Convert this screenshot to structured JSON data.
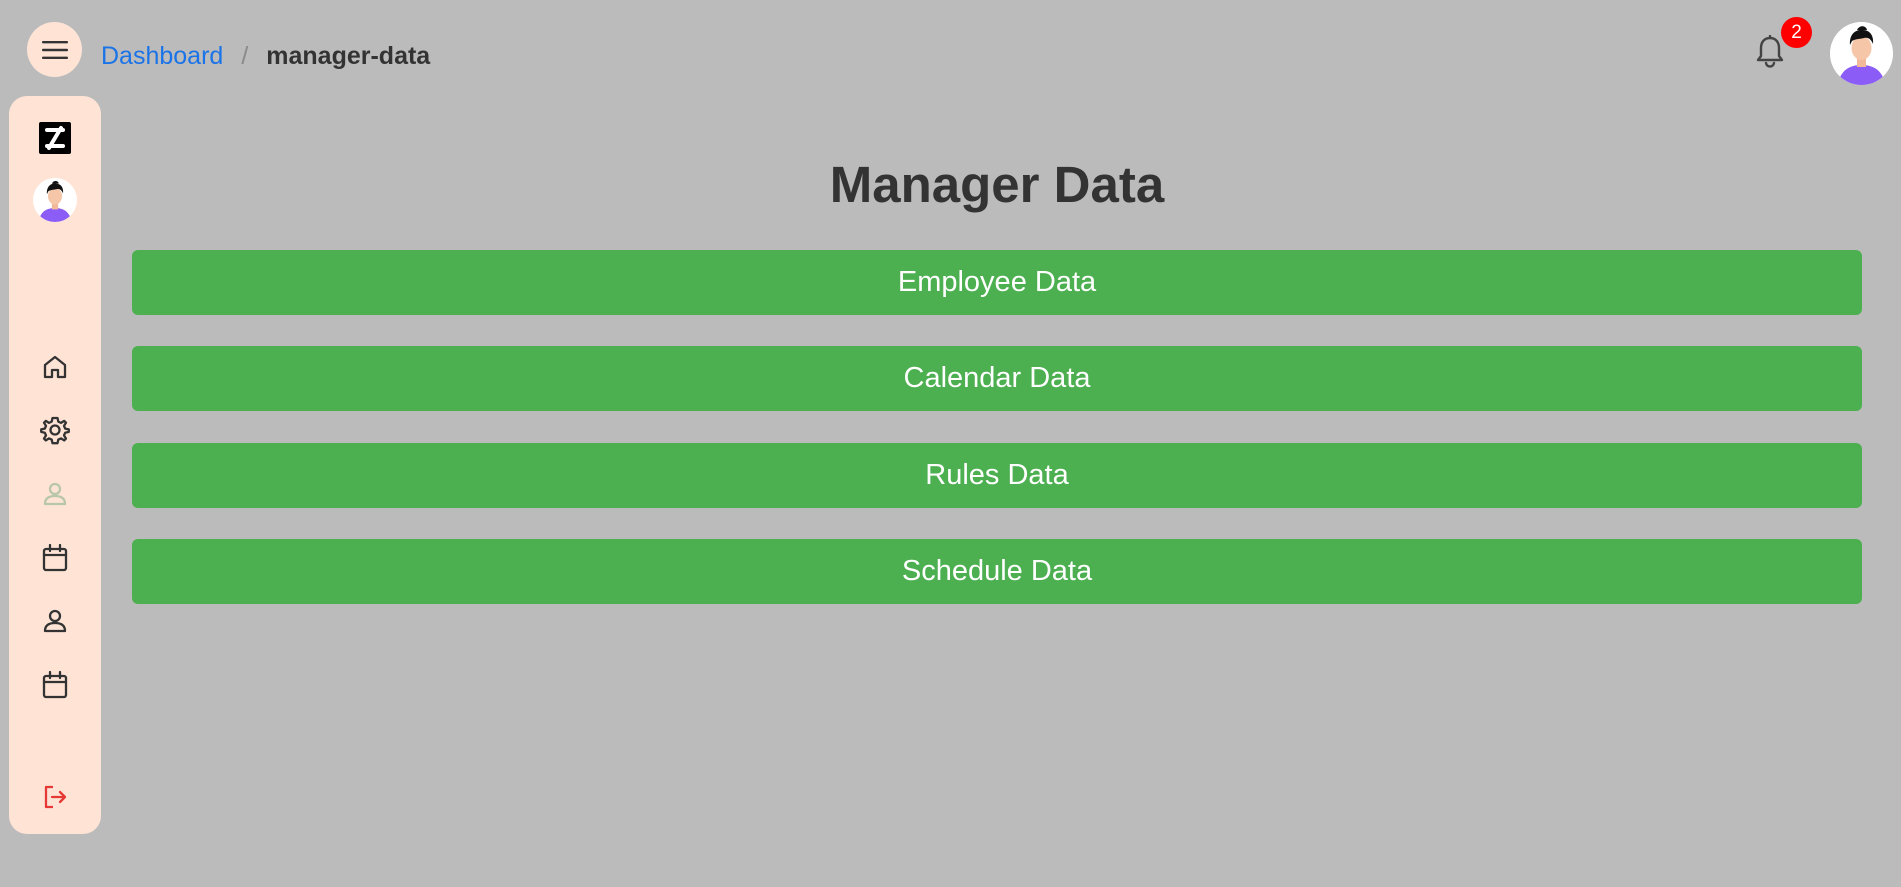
{
  "colors": {
    "background": "#bbbbbb",
    "sidebar_bg": "#ffe4d6",
    "menu_button_bg": "#ffe4d6",
    "link": "#1a73e8",
    "button_bg": "#4caf50",
    "badge_bg": "#ff0000",
    "logout": "#e53935",
    "active_icon": "#b7c7a7"
  },
  "header": {
    "menu_icon": "hamburger-icon",
    "breadcrumb": {
      "root_label": "Dashboard",
      "separator": "/",
      "current_label": "manager-data"
    },
    "notifications": {
      "icon": "bell-icon",
      "count": "2"
    },
    "avatar_icon": "user-avatar"
  },
  "sidebar": {
    "logo_icon": "logo-icon",
    "avatar_icon": "user-avatar",
    "items": [
      {
        "name": "home",
        "icon": "home-icon"
      },
      {
        "name": "settings",
        "icon": "gear-icon"
      },
      {
        "name": "user",
        "icon": "person-icon",
        "active": true
      },
      {
        "name": "calendar",
        "icon": "calendar-icon"
      },
      {
        "name": "profile",
        "icon": "person-icon"
      },
      {
        "name": "schedule",
        "icon": "calendar-icon"
      }
    ],
    "logout_icon": "logout-icon"
  },
  "main": {
    "title": "Manager Data",
    "buttons": [
      {
        "label": "Employee Data"
      },
      {
        "label": "Calendar Data"
      },
      {
        "label": "Rules Data"
      },
      {
        "label": "Schedule Data"
      }
    ]
  }
}
